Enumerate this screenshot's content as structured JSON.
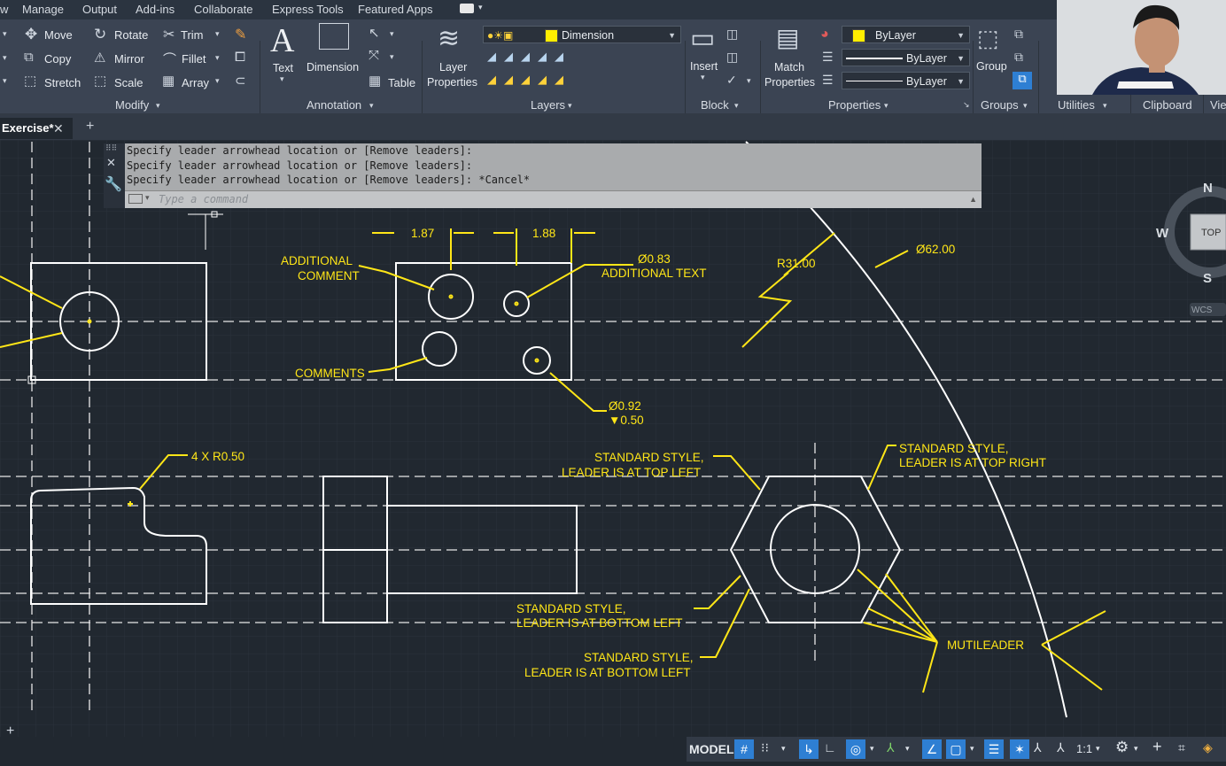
{
  "menu": [
    "w",
    "Manage",
    "Output",
    "Add-ins",
    "Collaborate",
    "Express Tools",
    "Featured Apps"
  ],
  "modify": {
    "move": "Move",
    "rotate": "Rotate",
    "trim": "Trim",
    "copy": "Copy",
    "mirror": "Mirror",
    "fillet": "Fillet",
    "stretch": "Stretch",
    "scale": "Scale",
    "array": "Array",
    "title": "Modify"
  },
  "annotation": {
    "text": "Text",
    "dimension": "Dimension",
    "table": "Table",
    "title": "Annotation"
  },
  "layers": {
    "layer_properties_1": "Layer",
    "layer_properties_2": "Properties",
    "current_layer": "Dimension",
    "title": "Layers"
  },
  "block": {
    "insert": "Insert",
    "title": "Block"
  },
  "properties": {
    "match_1": "Match",
    "match_2": "Properties",
    "color": "ByLayer",
    "linetype": "ByLayer",
    "lineweight": "ByLayer",
    "title": "Properties"
  },
  "groups": {
    "group": "Group",
    "title": "Groups"
  },
  "utilities": {
    "title": "Utilities"
  },
  "clipboard": {
    "title": "Clipboard"
  },
  "view": {
    "title": "Vie"
  },
  "file_tab": {
    "name": "Exercise*"
  },
  "command": {
    "history": [
      "Specify leader arrowhead location or [Remove leaders]:",
      "Specify leader arrowhead location or [Remove leaders]:",
      "Specify leader arrowhead location or [Remove leaders]: *Cancel*"
    ],
    "placeholder": "Type a command"
  },
  "viewcube": {
    "north": "N",
    "south": "S",
    "west": "W",
    "top": "TOP",
    "wcs": "WCS"
  },
  "annotations": {
    "dim_187": "1.87",
    "dim_188": "1.88",
    "additional_comment_1": "ADDITIONAL",
    "additional_comment_2": "COMMENT",
    "dia_083": "Ø0.83",
    "additional_text": "ADDITIONAL TEXT",
    "comments": "COMMENTS",
    "dia_092": "Ø0.92",
    "depth_050": "▼0.50",
    "r3100": "R31.00",
    "dia_6200": "Ø62.00",
    "four_r050": "4 X R0.50",
    "std_top_left_1": "STANDARD STYLE,",
    "std_top_left_2": "LEADER IS AT TOP LEFT",
    "std_top_right_1": "STANDARD STYLE,",
    "std_top_right_2": "LEADER IS AT TOP RIGHT",
    "std_bottom_left_a_1": "STANDARD STYLE,",
    "std_bottom_left_a_2": "LEADER IS AT BOTTOM LEFT",
    "std_bottom_left_b_1": "STANDARD STYLE,",
    "std_bottom_left_b_2": "LEADER IS AT BOTTOM LEFT",
    "multileader": "MUTILEADER"
  },
  "status": {
    "model": "MODEL",
    "scale": "1:1"
  },
  "colors": {
    "canvas": "#212830",
    "annotation": "#ffe617",
    "geometry": "#ffffff",
    "ribbon": "#3b4453"
  }
}
